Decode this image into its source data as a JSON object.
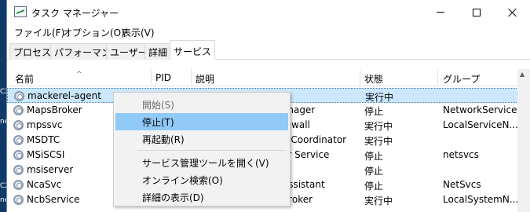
{
  "window": {
    "title": "タスク マネージャー"
  },
  "menubar": {
    "items": [
      "ファイル(F)",
      "オプション(O)",
      "表示(V)"
    ]
  },
  "tabs": [
    "プロセス",
    "パフォーマンス",
    "ユーザー",
    "詳細",
    "サービス"
  ],
  "active_tab": "サービス",
  "table": {
    "columns": [
      "名前",
      "PID",
      "説明",
      "状態",
      "グループ"
    ],
    "rows": [
      {
        "name": "mackerel-agent",
        "pid": "",
        "description": "",
        "status": "実行中",
        "group": ""
      },
      {
        "name": "MapsBroker",
        "pid": "",
        "description": "anager",
        "status": "停止",
        "group": "NetworkService"
      },
      {
        "name": "mpssvc",
        "pid": "",
        "description": "rewall",
        "status": "実行中",
        "group": "LocalServiceN..."
      },
      {
        "name": "MSDTC",
        "pid": "",
        "description": "n Coordinator",
        "status": "実行中",
        "group": ""
      },
      {
        "name": "MSiSCSI",
        "pid": "",
        "description": "or Service",
        "status": "停止",
        "group": "netsvcs"
      },
      {
        "name": "msiserver",
        "pid": "",
        "description": "",
        "status": "停止",
        "group": ""
      },
      {
        "name": "NcaSvc",
        "pid": "",
        "description": "Assistant",
        "status": "停止",
        "group": "NetSvcs"
      },
      {
        "name": "NcbService",
        "pid": "",
        "description": "Broker",
        "status": "実行中",
        "group": "LocalSystemN..."
      }
    ]
  },
  "context_menu": {
    "items": [
      {
        "label": "開始(S)",
        "disabled": true
      },
      {
        "label": "停止(T)",
        "hover": true
      },
      {
        "label": "再起動(R)"
      },
      {
        "label": "サービス管理ツールを開く(V)"
      },
      {
        "label": "オンライン検索(O)"
      },
      {
        "label": "詳細の表示(D)"
      }
    ]
  },
  "desktop_fragments": [
    "C2",
    "ne",
    "C2",
    "ne"
  ],
  "colors": {
    "selected_row": "#cce8ff",
    "menu_hover": "#91c9f7",
    "desktop": "#0a2a52"
  }
}
